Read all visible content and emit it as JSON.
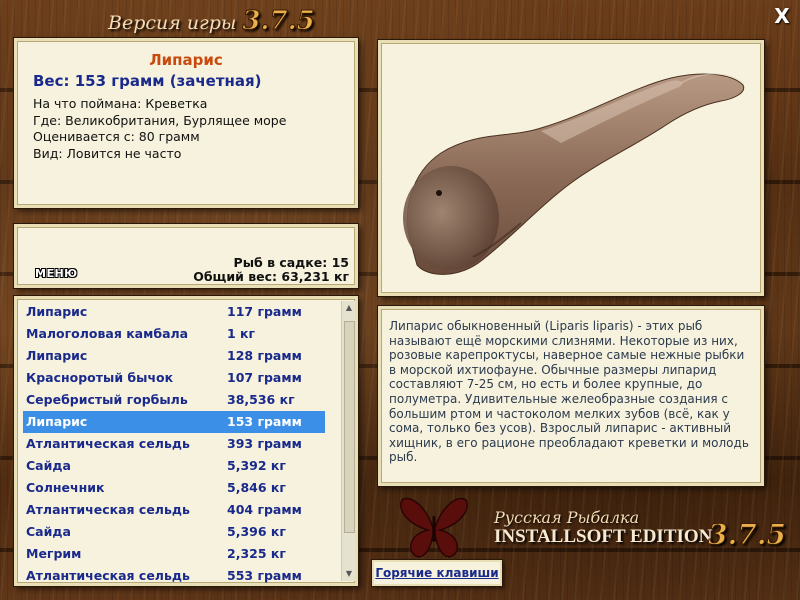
{
  "header": {
    "version_label": "Версия игры",
    "version_number": "3.7.5",
    "close_label": "X"
  },
  "fish_info": {
    "name": "Липарис",
    "weight": "Вес: 153 грамм (зачетная)",
    "lines": [
      "На что поймана: Креветка",
      "Где: Великобритания, Бурлящее море",
      "Оценивается с: 80 грамм",
      "Вид: Ловится не часто"
    ]
  },
  "stats": {
    "menu_label": "МЕНЮ",
    "fish_in_cage": "Рыб в садке: 15",
    "total_weight": "Общий вес: 63,231 кг"
  },
  "catch_list": {
    "selected_index": 5,
    "rows": [
      {
        "name": "Липарис",
        "weight": "117 грамм"
      },
      {
        "name": "Малоголовая камбала",
        "weight": "1 кг"
      },
      {
        "name": "Липарис",
        "weight": "128 грамм"
      },
      {
        "name": "Красноротый бычок",
        "weight": "107 грамм"
      },
      {
        "name": "Серебристый горбыль",
        "weight": "38,536 кг"
      },
      {
        "name": "Липарис",
        "weight": "153 грамм"
      },
      {
        "name": "Атлантическая сельдь",
        "weight": "393 грамм"
      },
      {
        "name": "Сайда",
        "weight": "5,392 кг"
      },
      {
        "name": "Солнечник",
        "weight": "5,846 кг"
      },
      {
        "name": "Атлантическая сельдь",
        "weight": "404 грамм"
      },
      {
        "name": "Сайда",
        "weight": "5,396 кг"
      },
      {
        "name": "Мегрим",
        "weight": "2,325 кг"
      },
      {
        "name": "Атлантическая сельдь",
        "weight": "553 грамм"
      }
    ]
  },
  "description": "Липарис обыкновенный (Liparis liparis) - этих рыб называют ещё морскими слизнями. Некоторые из них, розовые карепроктусы, наверное самые нежные рыбки в морской ихтиофауне. Обычные размеры липарид составляют 7-25 см, но есть и более крупные, до полуметра. Удивительные желеобразные создания с большим ртом и частоколом мелких зубов (всё, как у сома, только без усов). Взрослый липарис - активный хищник, в его рационе преобладают креветки и молодь рыб.",
  "footer": {
    "hotkeys_label": "Горячие клавиши",
    "brand_line1": "Русская Рыбалка",
    "brand_line2": "INSTALLSOFT EDITION",
    "brand_version": "3.7.5"
  },
  "icons": {
    "close": "close-icon",
    "logo": "butterfly-logo-icon",
    "scroll_up": "scroll-up-arrow-icon",
    "scroll_down": "scroll-down-arrow-icon"
  },
  "colors": {
    "fish_name": "#c84a0c",
    "list_text": "#1a2a8c",
    "selection": "#3b8fe6",
    "panel_bg": "#f6f2dd",
    "version_accent": "#e9b04a",
    "wood": "#5a3214"
  }
}
